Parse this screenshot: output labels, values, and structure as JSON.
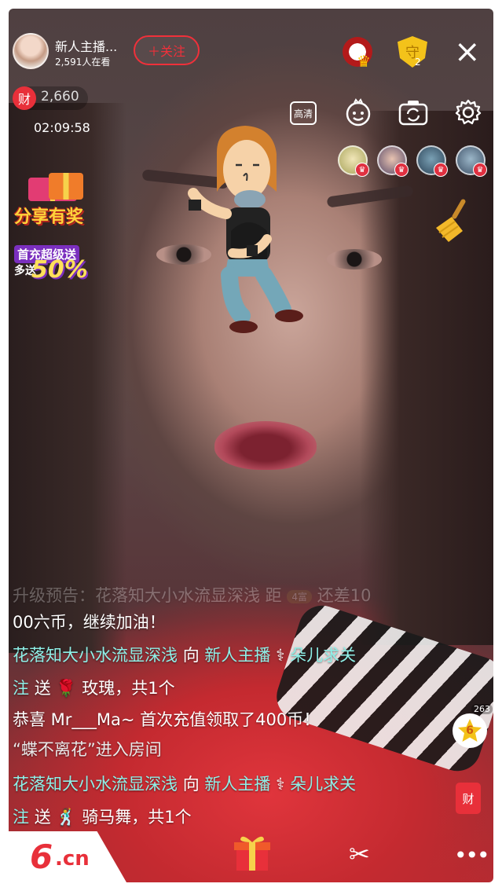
{
  "header": {
    "host_name": "新人主播...",
    "viewers": "2,591人在看",
    "follow_label": "＋关注",
    "guard_icon_text": "守",
    "guard_count": "2",
    "close_label": "×"
  },
  "stats": {
    "wealth_icon_text": "财",
    "wealth_value": "2,660",
    "timer": "02:09:58"
  },
  "controls": {
    "hd_label": "高清"
  },
  "promos": {
    "share_label": "分享有奖",
    "promo_top": "首充超级送",
    "promo_bottom": "多送",
    "promo_percent": "50%"
  },
  "chat": [
    {
      "text": "升级预告：花落知大小水流显深浅 距",
      "level": "4富",
      "tail": "还差10",
      "faded": true
    },
    {
      "text": "00六币，继续加油！"
    },
    {
      "line1_nick": "花落知大小水流显深浅",
      "line1_mid": "向",
      "line1_nick2": "新人主播",
      "line1_nick3": "朵儿求关"
    },
    {
      "nick": "注",
      "text": "送",
      "gift": "玫瑰，共1个"
    },
    {
      "text": "恭喜 Mr___Ma~ 首次充值领取了400币！"
    },
    {
      "text": "“蝶不离花”进入房间"
    },
    {
      "line1_nick": "花落知大小水流显深浅",
      "line1_mid": "向",
      "line1_nick2": "新人主播",
      "line1_nick3": "朵儿求关"
    },
    {
      "nick": "注",
      "text": "送",
      "gift": "骑马舞，共1个"
    }
  ],
  "side": {
    "star_count": "263",
    "star_level": "6",
    "cai_label": "财"
  },
  "bottom": {
    "logo_six": "6",
    "logo_cn": ".cn",
    "more_label": "•••"
  },
  "colors": {
    "accent_red": "#e8303a",
    "nick_cyan": "#8ff0e8",
    "gold": "#f3c21a"
  }
}
